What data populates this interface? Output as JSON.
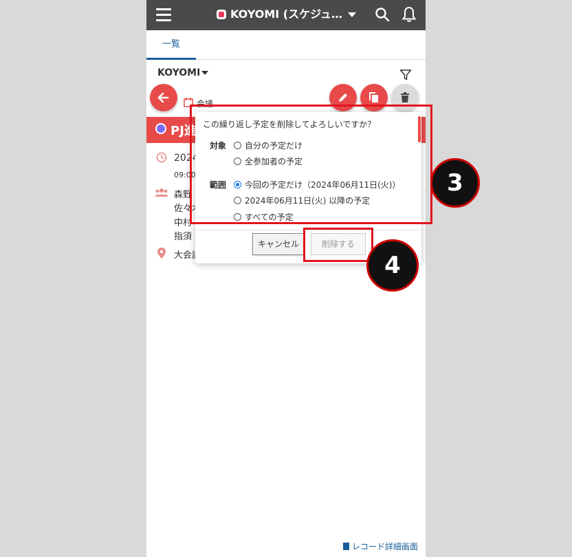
{
  "header": {
    "app_title": "KOYOMI (スケジュ…"
  },
  "tabs": [
    {
      "label": "一覧"
    }
  ],
  "view": {
    "selected": "KOYOMI"
  },
  "record": {
    "category": "会議",
    "title_fragment": "PJ進",
    "date_fragment": "2024",
    "time_fragment": "09:00",
    "attendee_fragments": [
      "森野",
      "佐々木",
      "中村",
      "指須"
    ],
    "location_fragment": "大会議"
  },
  "dialog": {
    "question": "この繰り返し予定を削除してよろしいですか？",
    "target_label": "対象",
    "target_options": [
      {
        "label": "自分の予定だけ",
        "checked": false
      },
      {
        "label": "全参加者の予定",
        "checked": false
      }
    ],
    "range_label": "範囲",
    "range_options": [
      {
        "label": "今回の予定だけ（2024年06月11日(火)）",
        "checked": true
      },
      {
        "label": "2024年06月11日(火) 以降の予定",
        "checked": false
      },
      {
        "label": "すべての予定",
        "checked": false
      }
    ],
    "cancel_label": "キャンセル",
    "delete_label": "削除する"
  },
  "footer": {
    "record_link": "レコード詳細画面"
  },
  "annotations": {
    "step_a": "3",
    "step_b": "4"
  },
  "colors": {
    "accent_red": "#e84a4a",
    "topbar": "#4a4a4a",
    "link_blue": "#1a5e9a",
    "highlight": "#e0141e"
  }
}
